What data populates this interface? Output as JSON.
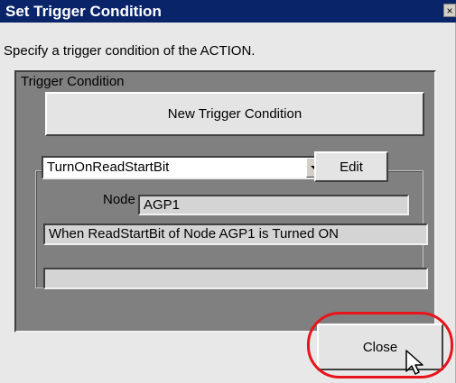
{
  "window": {
    "title": "Set Trigger Condition",
    "close_glyph": "×"
  },
  "instruction": "Specify a trigger condition of the ACTION.",
  "trigger_group": {
    "label": "Trigger Condition",
    "new_button_label": "New Trigger Condition",
    "selected_condition": "TurnOnReadStartBit",
    "edit_button_label": "Edit",
    "node_label": "Node",
    "node_value": "AGP1",
    "description": "When ReadStartBit of Node AGP1 is Turned ON",
    "extra_value": ""
  },
  "footer": {
    "close_button_label": "Close"
  },
  "colors": {
    "titlebar": "#0a246a",
    "highlight": "#e8141c",
    "panel": "#808080"
  }
}
